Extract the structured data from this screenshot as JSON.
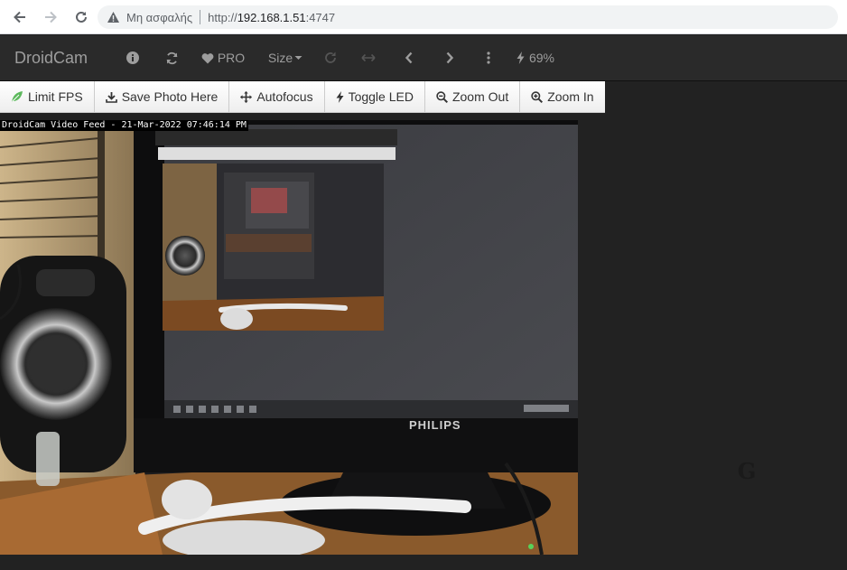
{
  "browser": {
    "insecure_label": "Μη ασφαλής",
    "url_proto": "http://",
    "url_host": "192.168.1.51",
    "url_port": ":4747"
  },
  "navbar": {
    "brand": "DroidCam",
    "pro_label": "PRO",
    "size_label": "Size",
    "battery": "69%"
  },
  "toolbar": {
    "limit_fps": "Limit FPS",
    "save_photo": "Save Photo Here",
    "autofocus": "Autofocus",
    "toggle_led": "Toggle LED",
    "zoom_out": "Zoom Out",
    "zoom_in": "Zoom In"
  },
  "video": {
    "caption": "DroidCam Video Feed - 21-Mar-2022 07:46:14 PM",
    "monitor_brand": "PHILIPS"
  },
  "watermark": {
    "letter": "G"
  },
  "colors": {
    "navbar_bg": "#2a2a2a",
    "page_bg": "#222222",
    "leaf_green": "#5cb85c"
  }
}
